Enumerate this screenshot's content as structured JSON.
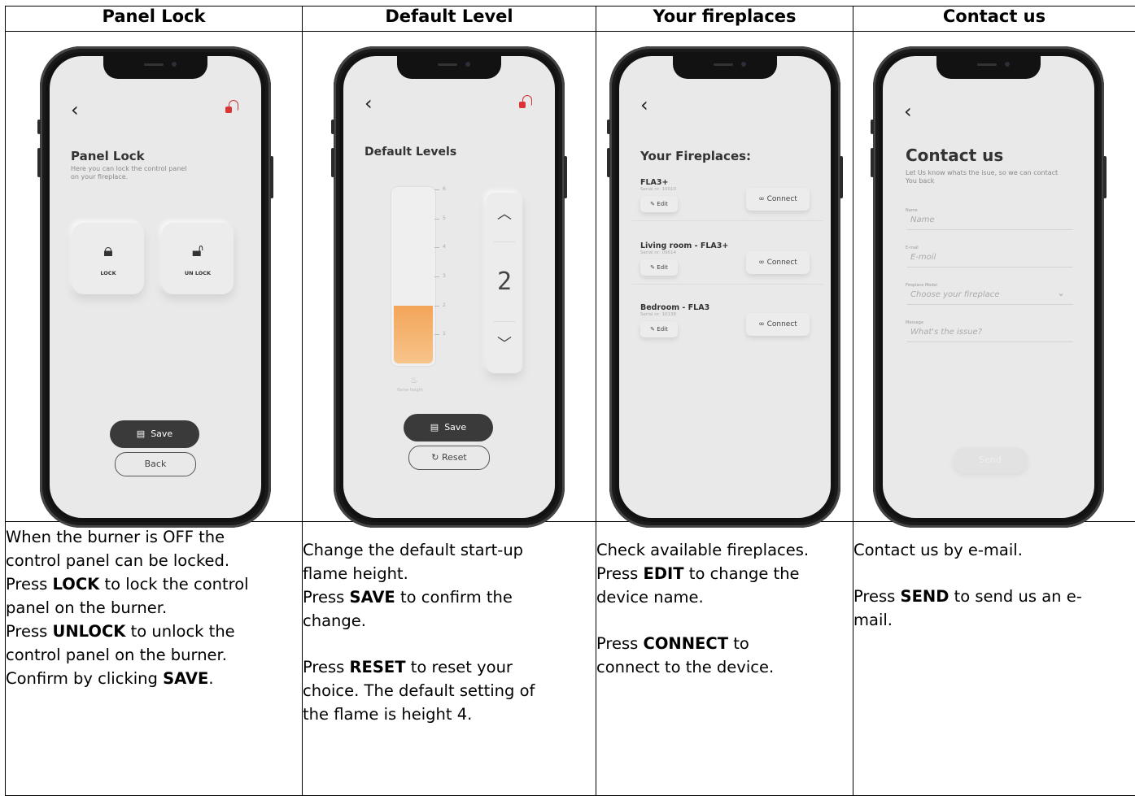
{
  "headers": [
    "Panel Lock",
    "Default Level",
    "Your fireplaces",
    "Contact us"
  ],
  "screens": {
    "panel_lock": {
      "back": "‹",
      "title": "Panel Lock",
      "subtitle_1": "Here you can lock the control panel",
      "subtitle_2": "on your fireplace.",
      "lock_label": "LOCK",
      "unlock_label": "UN LOCK",
      "save_label": "Save",
      "back_label": "Back"
    },
    "default_levels": {
      "back": "‹",
      "title": "Default Levels",
      "ticks": [
        "6",
        "5",
        "4",
        "3",
        "2",
        "1"
      ],
      "level_value": "2",
      "level_fraction": 0.33,
      "flame_label": "flame height",
      "save_label": "Save",
      "reset_label": "Reset"
    },
    "fireplaces": {
      "back": "‹",
      "title": "Your Fireplaces:",
      "items": [
        {
          "name": "FLA3+",
          "serial": "Serial nr: 10010",
          "edit": "Edit",
          "connect": "Connect"
        },
        {
          "name": "Living room - FLA3+",
          "serial": "Serial nr: 09614",
          "edit": "Edit",
          "connect": "Connect"
        },
        {
          "name": "Bedroom - FLA3",
          "serial": "Serial nr: 10138",
          "edit": "Edit",
          "connect": "Connect"
        }
      ]
    },
    "contact": {
      "back": "‹",
      "title": "Contact us",
      "subtitle_1": "Let Us know whats the isue, so we can contact",
      "subtitle_2": "You back",
      "fields": [
        {
          "label": "Name",
          "placeholder": "Name"
        },
        {
          "label": "E-mail",
          "placeholder": "E-moil"
        },
        {
          "label": "Fireplace Model",
          "placeholder": "Choose your fireplace"
        },
        {
          "label": "Message",
          "placeholder": "What's the issue?"
        }
      ],
      "send_label": "Send"
    }
  },
  "descriptions": {
    "panel_lock": {
      "l1": "When the burner is OFF the",
      "l2": "control panel can be locked.",
      "l3a": "Press ",
      "l3b": "LOCK",
      "l3c": " to lock the control",
      "l4": "panel on the burner.",
      "l5a": "Press ",
      "l5b": "UNLOCK",
      "l5c": " to unlock the",
      "l6": "control panel on the burner.",
      "l7a": "Confirm by clicking ",
      "l7b": "SAVE",
      "l7c": "."
    },
    "default_level": {
      "l1": "Change the default start-up",
      "l2": "flame height.",
      "l3a": "Press ",
      "l3b": "SAVE",
      "l3c": " to confirm the",
      "l4": "change.",
      "l5a": "Press ",
      "l5b": "RESET",
      "l5c": " to reset your",
      "l6": "choice. The default setting of",
      "l7": "the flame is height 4."
    },
    "fireplaces": {
      "l1": "Check available fireplaces.",
      "l2a": "Press ",
      "l2b": "EDIT",
      "l2c": " to change the",
      "l3": "device name.",
      "l4a": "Press ",
      "l4b": "CONNECT",
      "l4c": " to",
      "l5": "connect to the device."
    },
    "contact": {
      "l1": "Contact us by e-mail.",
      "l2a": "Press ",
      "l2b": "SEND",
      "l2c": " to send us an e-",
      "l3": "mail."
    }
  }
}
